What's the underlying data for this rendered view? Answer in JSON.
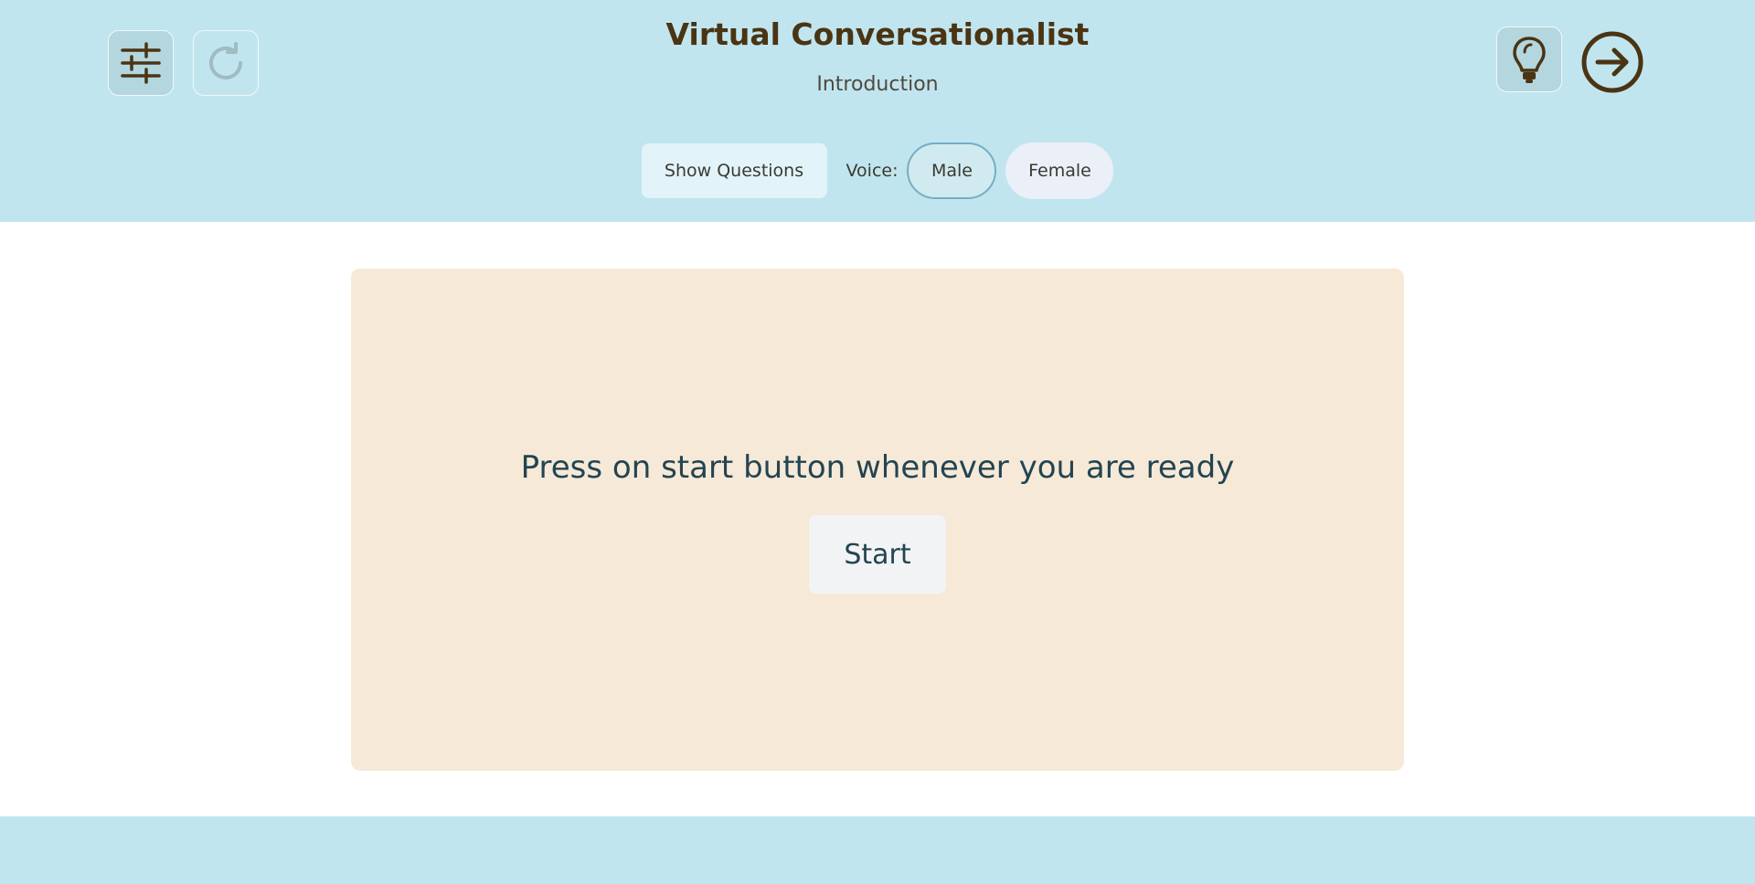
{
  "header": {
    "title": "Virtual Conversationalist",
    "subtitle": "Introduction",
    "settings_icon": "sliders-icon",
    "refresh_icon": "refresh-icon",
    "hint_icon": "lightbulb-icon",
    "next_icon": "arrow-right-circle-icon"
  },
  "controls": {
    "show_questions_label": "Show Questions",
    "voice_label": "Voice:",
    "voice_options": [
      "Male",
      "Female"
    ],
    "selected_voice": "Male"
  },
  "main": {
    "prompt": "Press on start button whenever you are ready",
    "start_label": "Start"
  },
  "colors": {
    "header_bg": "#c1e5ef",
    "card_bg": "#f6e9d7",
    "title_color": "#4a3413",
    "text_color": "#234452"
  }
}
